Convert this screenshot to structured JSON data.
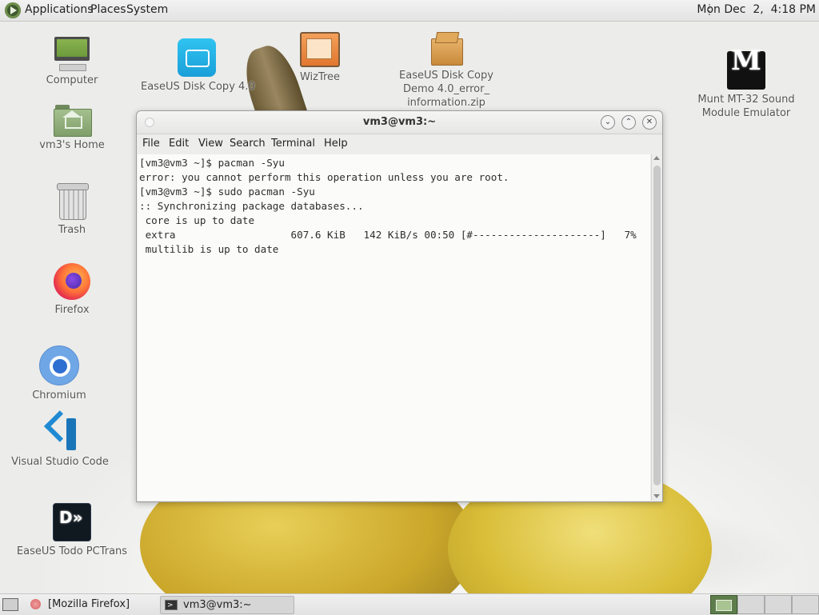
{
  "top_panel": {
    "menus": [
      "Applications",
      "Places",
      "System"
    ],
    "clock": "Mon Dec  2,  4:18 PM"
  },
  "desktop_icons": {
    "computer": "Computer",
    "home": "vm3's Home",
    "trash": "Trash",
    "firefox": "Firefox",
    "chromium": "Chromium",
    "vscode": "Visual Studio Code",
    "todo": "EaseUS Todo PCTrans",
    "easeus_copy": "EaseUS Disk Copy 4.0",
    "wiztree": "WizTree",
    "zip_line1": "EaseUS Disk Copy",
    "zip_line2": "Demo 4.0_error_",
    "zip_line3": "information.zip",
    "munt_line1": "Munt MT-32 Sound",
    "munt_line2": "Module Emulator"
  },
  "terminal": {
    "title": "vm3@vm3:~",
    "menu": [
      "File",
      "Edit",
      "View",
      "Search",
      "Terminal",
      "Help"
    ],
    "lines": [
      "[vm3@vm3 ~]$ pacman -Syu",
      "error: you cannot perform this operation unless you are root.",
      "[vm3@vm3 ~]$ sudo pacman -Syu",
      ":: Synchronizing package databases...",
      " core is up to date",
      " extra                   607.6 KiB   142 KiB/s 00:50 [#---------------------]   7%",
      " multilib is up to date"
    ],
    "minimize_icon": "chevron-down-icon",
    "maximize_icon": "chevron-up-icon",
    "close_icon": "close-icon"
  },
  "taskbar": {
    "tasks": [
      "[Mozilla Firefox]",
      "vm3@vm3:~"
    ]
  }
}
